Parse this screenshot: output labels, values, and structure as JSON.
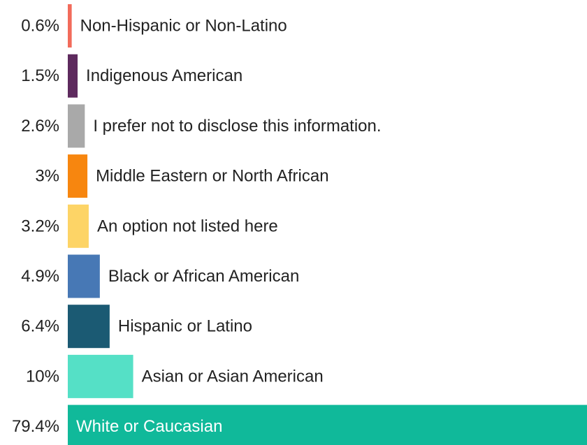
{
  "chart_data": {
    "type": "bar",
    "orientation": "horizontal",
    "title": "",
    "xlabel": "",
    "ylabel": "",
    "xlim": [
      0,
      79.4
    ],
    "grid": false,
    "legend": "none",
    "categories": [
      "Non-Hispanic or Non-Latino",
      "Indigenous American",
      "I prefer not to disclose this information.",
      "Middle Eastern or North African",
      "An option not listed here",
      "Black or African American",
      "Hispanic or Latino",
      "Asian or Asian American",
      "White or Caucasian"
    ],
    "values": [
      0.6,
      1.5,
      2.6,
      3,
      3.2,
      4.9,
      6.4,
      10,
      79.4
    ],
    "value_labels": [
      "0.6%",
      "1.5%",
      "2.6%",
      "3%",
      "3.2%",
      "4.9%",
      "6.4%",
      "10%",
      "79.4%"
    ],
    "colors": [
      "#f26b5b",
      "#5e2a5e",
      "#a9a9a9",
      "#f7860f",
      "#fdd466",
      "#4778b5",
      "#1b5a73",
      "#55e0c6",
      "#10b99a"
    ],
    "label_inside_bar": [
      false,
      false,
      false,
      false,
      false,
      false,
      false,
      false,
      true
    ]
  }
}
